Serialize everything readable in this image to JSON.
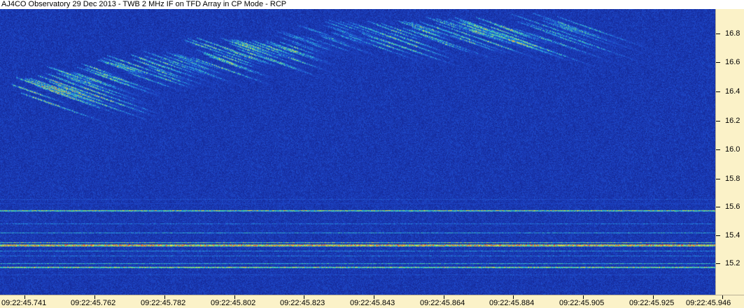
{
  "window": {
    "title": "AJ4CO Observatory 29 Dec 2013 - TWB 2 MHz IF on TFD Array in CP Mode - RCP"
  },
  "y_axis": {
    "unit": "",
    "labels": [
      "16.8",
      "16.6",
      "16.4",
      "16.2",
      "16.0",
      "15.8",
      "15.6",
      "15.4",
      "15.2"
    ]
  },
  "x_axis": {
    "labels": [
      "09:22:45.741",
      "09:22:45.762",
      "09:22:45.782",
      "09:22:45.802",
      "09:22:45.823",
      "09:22:45.843",
      "09:22:45.864",
      "09:22:45.884",
      "09:22:45.905",
      "09:22:45.925",
      "09:22:45.946"
    ]
  },
  "colors": {
    "background_noise": "#1b3fa6",
    "axis_background": "#fbf2c8"
  }
}
